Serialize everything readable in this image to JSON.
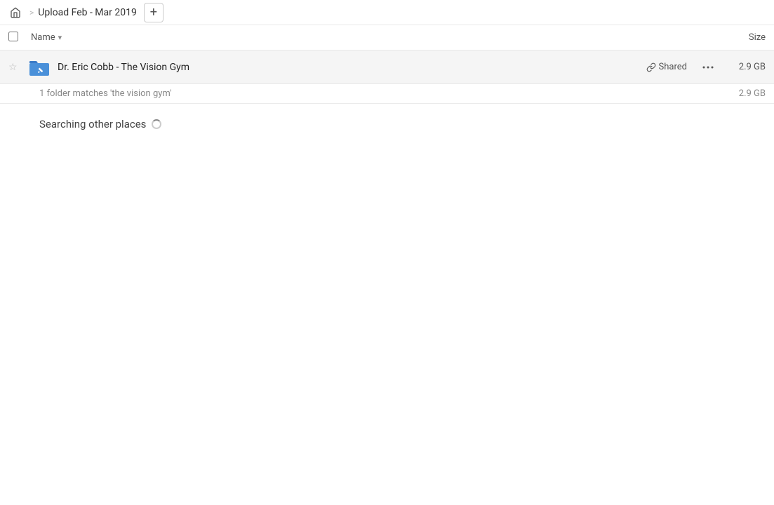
{
  "topbar": {
    "home_icon": "home",
    "separator": ">",
    "title": "Upload Feb - Mar 2019",
    "add_btn_label": "+"
  },
  "columns": {
    "checkbox_label": "select-all",
    "name_label": "Name",
    "sort_icon": "▾",
    "size_label": "Size"
  },
  "file_row": {
    "star_icon": "☆",
    "folder_name": "Dr. Eric Cobb - The Vision Gym",
    "shared_label": "Shared",
    "more_icon": "···",
    "size": "2.9 GB"
  },
  "match_bar": {
    "text": "1 folder matches 'the vision gym'",
    "size": "2.9 GB"
  },
  "searching_section": {
    "title": "Searching other places"
  }
}
